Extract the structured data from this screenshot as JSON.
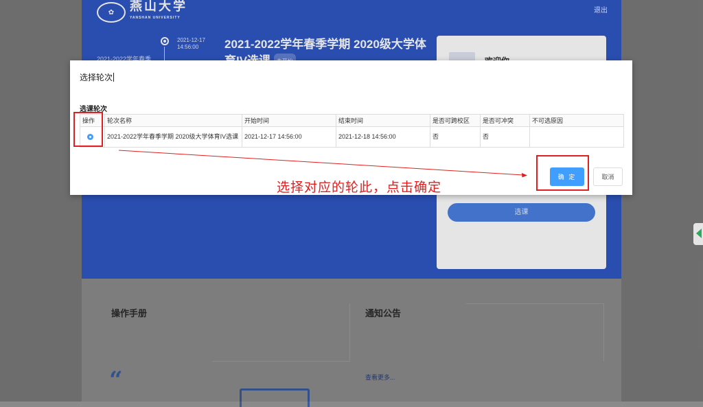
{
  "header": {
    "logo_text": "燕山大学",
    "logo_sub": "YANSHAN UNIVERSITY",
    "logout": "退出"
  },
  "banner": {
    "timeline_date": "2021-12-17",
    "timeline_time": "14:56:00",
    "round_left_label": "2021-2022学年春季",
    "title": "2021-2022学年春季学期 2020级大学体育IV选课",
    "status": "未开始"
  },
  "card": {
    "welcome": "欢迎你",
    "select_button": "选课"
  },
  "lower": {
    "manual_title": "操作手册",
    "notice_title": "通知公告",
    "more_link": "查看更多..."
  },
  "dialog": {
    "title": "选择轮次",
    "section_label": "选课轮次",
    "columns": [
      "操作",
      "轮次名称",
      "开始时间",
      "结束时间",
      "是否可跨校区",
      "是否可冲突",
      "不可选原因"
    ],
    "rows": [
      {
        "name": "2021-2022学年春季学期 2020级大学体育IV选课",
        "start": "2021-12-17 14:56:00",
        "end": "2021-12-18 14:56:00",
        "cross_campus": "否",
        "conflict": "否",
        "reason": ""
      }
    ],
    "confirm_button": "确 定",
    "cancel_button": "取消"
  },
  "annotation": {
    "text": "选择对应的轮此，点击确定",
    "color": "#e02020"
  },
  "colors": {
    "primary": "#409eff",
    "banner": "#2f57c5"
  }
}
